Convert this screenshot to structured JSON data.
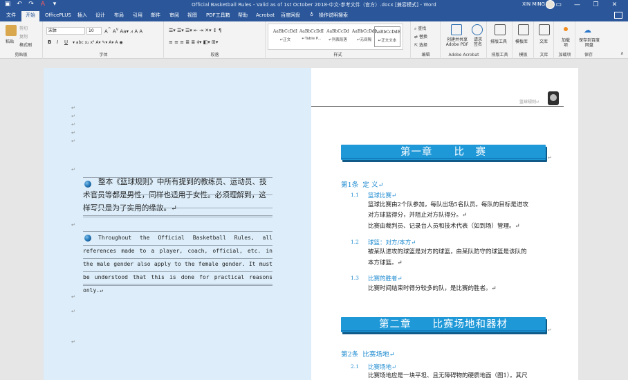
{
  "titlebar": {
    "title": "Official Basketball Rules - Valid as of 1st October 2018-中文-参考文件（官方）.docx [兼容模式] - Word",
    "user": "XIN MING"
  },
  "tabs": [
    "文件",
    "开始",
    "OfficePLUS",
    "插入",
    "设计",
    "布局",
    "引用",
    "邮件",
    "审阅",
    "视图",
    "PDF工具箱",
    "帮助",
    "Acrobat",
    "百度网盘"
  ],
  "active_tab": "开始",
  "tell_me": "操作说明搜索",
  "ribbon": {
    "clipboard": {
      "paste": "粘贴",
      "cut": "剪切",
      "copy": "复制",
      "format_painter": "格式刷",
      "label": "剪贴板"
    },
    "font": {
      "name": "宋体",
      "size": "10",
      "label": "字体"
    },
    "paragraph": {
      "label": "段落"
    },
    "styles": {
      "label": "样式",
      "items": [
        {
          "preview": "AaBbCcDdI",
          "name": "↵正文"
        },
        {
          "preview": "AaBbCcDdI",
          "name": "↵Table P..."
        },
        {
          "preview": "AaBbCcDd",
          "name": "↵列表段落"
        },
        {
          "preview": "AaBbCcDdI",
          "name": "↵无间隔"
        },
        {
          "preview": "AaBbCcDdE",
          "name": "↵正文文本"
        }
      ]
    },
    "editing": {
      "find": "查找",
      "replace": "替换",
      "select": "选择",
      "label": "编辑"
    },
    "acrobat": {
      "create": "创建并共享 Adobe PDF",
      "request": "请求签名",
      "label": "Adobe Acrobat"
    },
    "layout_tools": {
      "button": "排版工具",
      "label": "排版工具"
    },
    "templates": {
      "button": "模板库",
      "label": "模板"
    },
    "wenku": {
      "button": "文库",
      "label": "文库"
    },
    "addins": {
      "button": "加载项",
      "label": "加载项"
    },
    "save": {
      "button": "保存到百度网盘",
      "label": "保存"
    }
  },
  "left_page": {
    "zh_note": "整本《篮球规则》中所有提到的教练员、运动员、技术官员等都是男性，同样也适用于女性。必须理解到，这样写只是为了实用的缘故。↵",
    "en_note": "Throughout the Official Basketball Rules, all references made to a player, coach, official, etc. in the male gender also apply to the female gender. It must be understood that this is done for practical reasons only.↵",
    "para_mark": "↵"
  },
  "right_page": {
    "header": "篮球规则↵",
    "chapter1": "第一章　　比　赛",
    "article1": {
      "num": "第1条",
      "title": "定 义↵"
    },
    "s1_1": {
      "num": "1.1",
      "title": "篮球比赛↵",
      "lines": [
        "篮球比赛由2个队参加，每队出场5名队员。每队的目标是进攻",
        "对方球篮得分，并阻止对方队得分。↵",
        "比赛由裁判员、记录台人员和技术代表（如到场）管理。↵"
      ]
    },
    "s1_2": {
      "num": "1.2",
      "title": "球篮：对方/本方↵",
      "lines": [
        "被某队进攻的球篮是对方的球篮，由某队防守的球篮是该队的",
        "本方球篮。↵"
      ]
    },
    "s1_3": {
      "num": "1.3",
      "title": "比赛的胜者↵",
      "lines": [
        "比赛时间结束时得分较多的队，是比赛的胜者。↵"
      ]
    },
    "chapter2": "第二章　　比赛场地和器材",
    "article2": {
      "num": "第2条",
      "title": "比赛场地↵"
    },
    "s2_1": {
      "num": "2.1",
      "title": "比赛场地↵",
      "lines": [
        "比赛场地应是一块平坦、且无障碍物的硬质地面（图1）。其尺"
      ]
    }
  }
}
